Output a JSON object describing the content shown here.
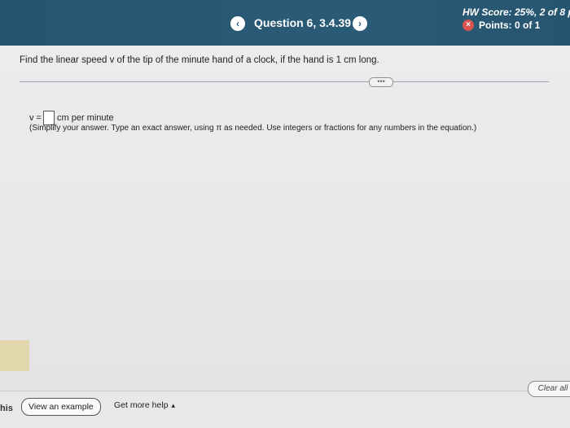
{
  "header": {
    "question_title": "Question 6, 3.4.39",
    "prev_icon": "chevron-left-icon",
    "next_icon": "chevron-right-icon",
    "hw_score": "HW Score: 25%, 2 of 8 p",
    "points": "Points: 0 of 1",
    "points_status_color": "#d9534f"
  },
  "question": {
    "text": "Find the linear speed v of the tip of the minute hand of a clock, if the hand is 1 cm long.",
    "more_label": "•••"
  },
  "answer": {
    "prefix": "v =",
    "input_value": "",
    "unit": "cm per minute",
    "instructions": "(Simplify your answer. Type an exact answer, using π as needed. Use integers or fractions for any numbers in the equation.)"
  },
  "footer": {
    "left_text": "his",
    "view_example": "View an example",
    "get_help": "Get more help",
    "help_caret": "▴",
    "clear_all": "Clear all"
  },
  "colors": {
    "header_bg": "#2a5b76",
    "accent_block": "#e3d7ad"
  }
}
